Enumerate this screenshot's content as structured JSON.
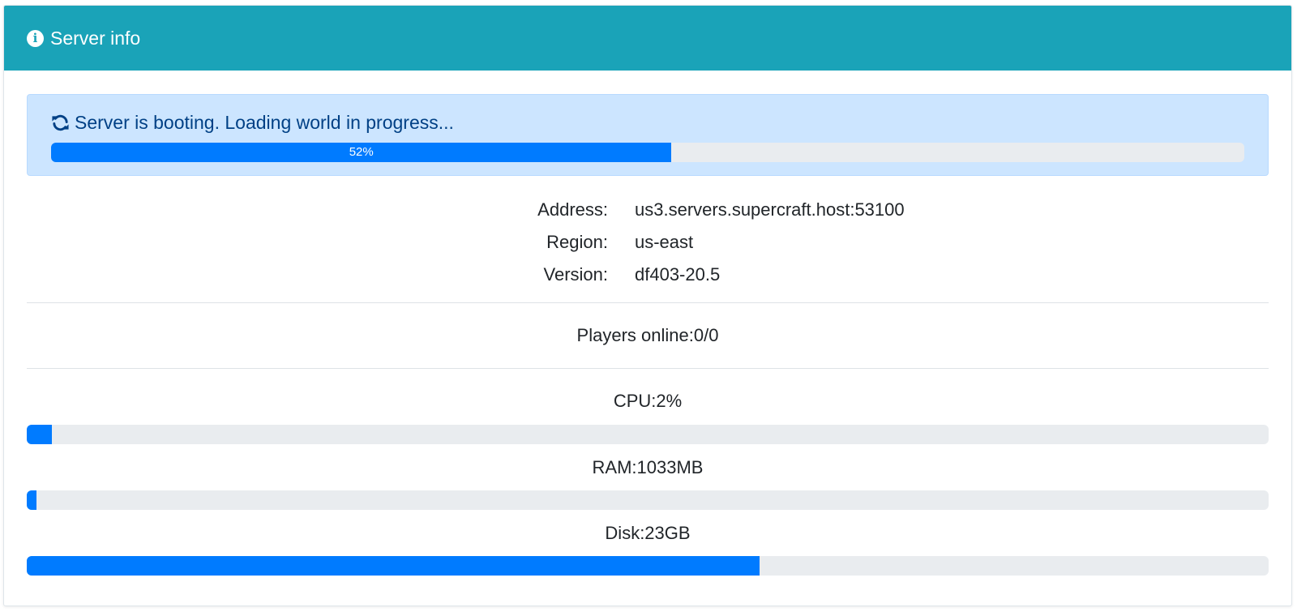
{
  "header": {
    "icon": "info-circle-icon",
    "title": "Server info",
    "background": "#1aa3b8"
  },
  "status_alert": {
    "icon": "refresh-icon",
    "message": "Server is booting. Loading world in progress...",
    "progress_percent": 52,
    "progress_label": "52%",
    "background": "#cce5ff",
    "bar_color": "#007bff"
  },
  "server_details": [
    {
      "label": "Address:",
      "value": "us3.servers.supercraft.host:53100"
    },
    {
      "label": "Region:",
      "value": "us-east"
    },
    {
      "label": "Version:",
      "value": "df403-20.5"
    }
  ],
  "players": {
    "text": "Players online:0/0"
  },
  "metrics": [
    {
      "label": "CPU:2%",
      "fill_percent": 2
    },
    {
      "label": "RAM:1033MB",
      "fill_percent": 0.8
    },
    {
      "label": "Disk:23GB",
      "fill_percent": 59
    }
  ]
}
